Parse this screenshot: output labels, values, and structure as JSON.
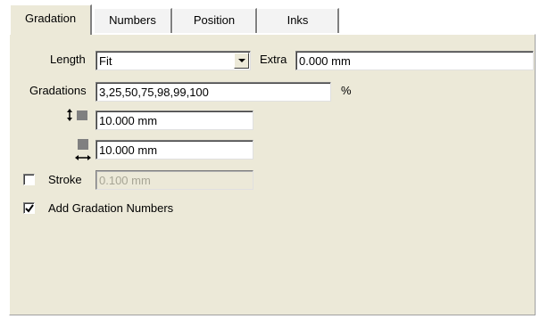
{
  "tabs": [
    {
      "label": "Gradation",
      "active": true
    },
    {
      "label": "Numbers",
      "active": false
    },
    {
      "label": "Position",
      "active": false
    },
    {
      "label": "Inks",
      "active": false
    }
  ],
  "length": {
    "label": "Length",
    "value": "Fit"
  },
  "extra": {
    "label": "Extra",
    "value": "0.000 mm"
  },
  "gradations": {
    "label": "Gradations",
    "value": "3,25,50,75,98,99,100",
    "unit": "%"
  },
  "height_field": {
    "value": "10.000 mm",
    "icon": "vertical-size-icon"
  },
  "width_field": {
    "value": "10.000 mm",
    "icon": "horizontal-size-icon"
  },
  "stroke": {
    "label": "Stroke",
    "checked": false,
    "value": "0.100 mm"
  },
  "add_numbers": {
    "label": "Add Gradation Numbers",
    "checked": true
  },
  "colors": {
    "panel": "#ece9d8",
    "tab_inactive": "#f3f3f3",
    "disabled_text": "#a7a595"
  }
}
